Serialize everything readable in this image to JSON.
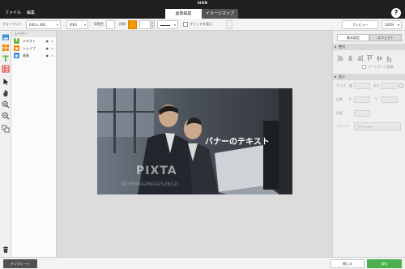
{
  "brand": "SION",
  "menu": [
    "ファイル",
    "編集"
  ],
  "mode_tabs": {
    "active": "画像編集",
    "inactive": "イメージマップ"
  },
  "help_label": "?",
  "toolbar": {
    "format_label": "フォーマット",
    "size_value": "640 x 360",
    "type_value": "JPEG",
    "bg_label": "背景色",
    "frame_label": "枠線",
    "frame_color": "#f39800",
    "grid_label": "グリッドを表示",
    "preview_label": "プレビュー",
    "zoom_value": "100%"
  },
  "tools": [
    "image-tool",
    "shape-tool",
    "text-tool",
    "table-tool",
    "select-tool",
    "hand-tool",
    "zoom-in-tool",
    "zoom-out-tool",
    "layer-order-tool",
    "trash-tool"
  ],
  "layers": {
    "header": "レイヤー",
    "items": [
      {
        "label": "テキスト",
        "color": "#6bb843",
        "glyph": "T"
      },
      {
        "label": "シェイプ",
        "color": "#f08300",
        "glyph": "■"
      },
      {
        "label": "画像",
        "color": "#3d8fd6",
        "glyph": "▣"
      }
    ]
  },
  "banner": {
    "text": "バナーのテキスト",
    "watermark": "PIXTA",
    "watermark_id": "ID:55004284(4252832)"
  },
  "props": {
    "tab_basic": "基本設定",
    "tab_effect": "エフェクト",
    "section_align": "整列",
    "artboard_label": "アートボード基準",
    "section_display": "表示",
    "size_label": "サイズ",
    "width_label": "幅",
    "height_label": "高さ",
    "pos_label": "位置",
    "x_label": "X",
    "y_label": "Y",
    "rotate_label": "回転",
    "blend_label": "ブレンド",
    "blend_value": "デフォルト"
  },
  "bottom": {
    "template_label": "テンプレート",
    "close_label": "閉じる",
    "save_label": "保存"
  }
}
